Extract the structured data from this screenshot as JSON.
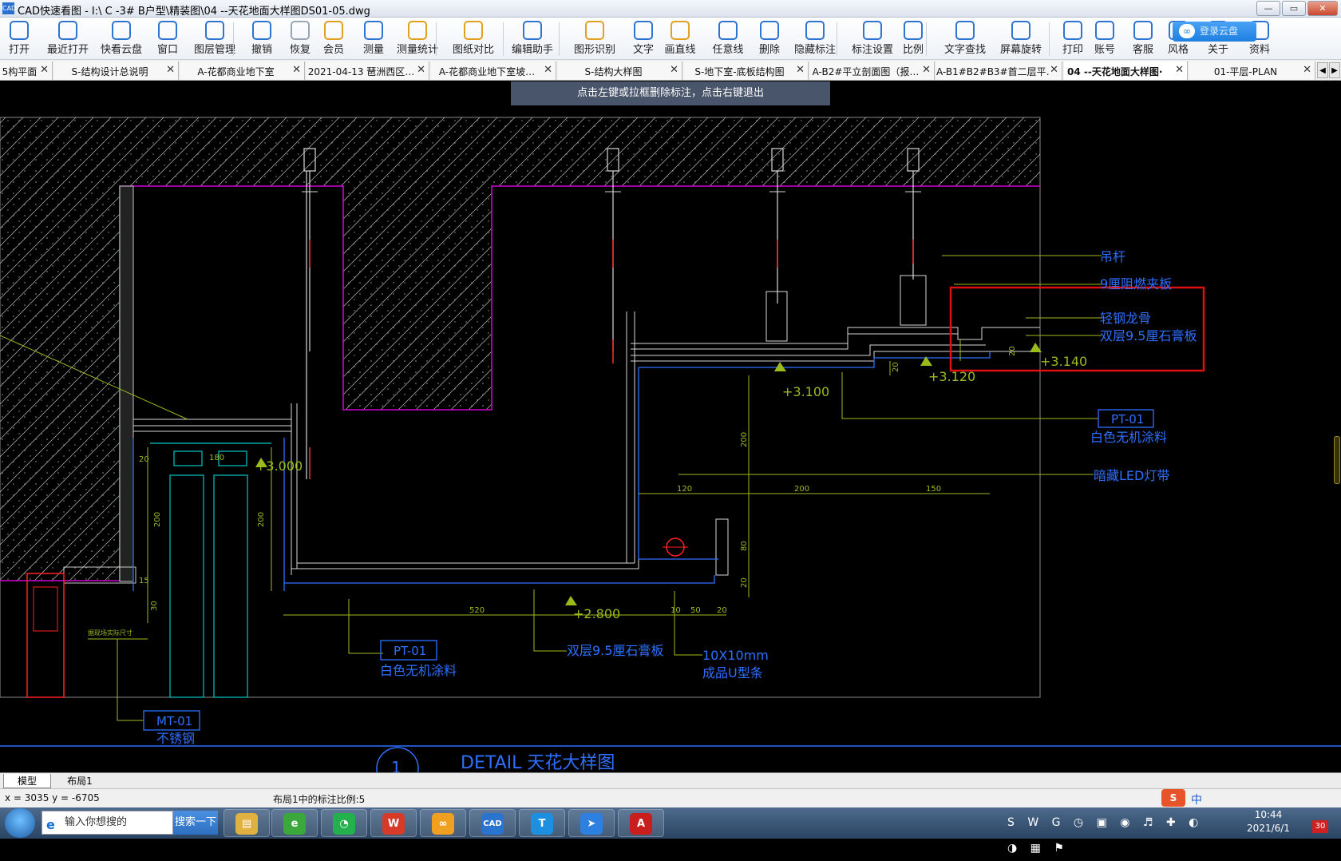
{
  "window": {
    "title": "CAD快速看图 - I:\\ C -3# B户型\\精装图\\04 --天花地面大样图DS01-05.dwg",
    "minimize": "—",
    "maximize": "▭",
    "close": "✕"
  },
  "toolbar": {
    "items": [
      {
        "label": "打开",
        "icon": "folder-open-icon"
      },
      {
        "label": "最近打开",
        "icon": "recent-clock-icon"
      },
      {
        "label": "快看云盘",
        "icon": "cloud-icon"
      },
      {
        "label": "窗口",
        "icon": "window-icon"
      },
      {
        "label": "图层管理",
        "icon": "layers-icon"
      },
      {
        "label": "撤销",
        "icon": "undo-icon"
      },
      {
        "label": "恢复",
        "icon": "redo-icon"
      },
      {
        "label": "会员",
        "icon": "vip-icon"
      },
      {
        "label": "测量",
        "icon": "measure-icon"
      },
      {
        "label": "测量统计",
        "icon": "measure-stats-icon"
      },
      {
        "label": "图纸对比",
        "icon": "compare-icon"
      },
      {
        "label": "编辑助手",
        "icon": "edit-assistant-icon"
      },
      {
        "label": "图形识别",
        "icon": "shape-recognition-icon"
      },
      {
        "label": "文字",
        "icon": "text-icon"
      },
      {
        "label": "画直线",
        "icon": "line-icon"
      },
      {
        "label": "任意线",
        "icon": "pen-icon"
      },
      {
        "label": "删除",
        "icon": "eraser-icon"
      },
      {
        "label": "隐藏标注",
        "icon": "eye-hide-icon"
      },
      {
        "label": "标注设置",
        "icon": "annotation-settings-icon"
      },
      {
        "label": "比例",
        "icon": "scale-icon"
      },
      {
        "label": "文字查找",
        "icon": "text-search-icon"
      },
      {
        "label": "屏幕旋转",
        "icon": "rotate-screen-icon"
      },
      {
        "label": "打印",
        "icon": "printer-icon"
      },
      {
        "label": "账号",
        "icon": "user-icon"
      },
      {
        "label": "客服",
        "icon": "headset-icon"
      },
      {
        "label": "风格",
        "icon": "style-icon"
      },
      {
        "label": "关于",
        "icon": "about-icon"
      },
      {
        "label": "资料",
        "icon": "docs-icon"
      }
    ],
    "cloud_button": "登录云盘"
  },
  "tabs": [
    {
      "label": "5构平面"
    },
    {
      "label": "S-结构设计总说明"
    },
    {
      "label": "A-花都商业地下室"
    },
    {
      "label": "2021-04-13 琶洲西区…"
    },
    {
      "label": "A-花都商业地下室坡…"
    },
    {
      "label": "S-结构大样图"
    },
    {
      "label": "S-地下室-底板结构图"
    },
    {
      "label": "A-B2#平立剖面图（报…"
    },
    {
      "label": "A-B1#B2#B3#首二层平…"
    },
    {
      "label": "04 --天花地面大样图·",
      "active": true
    },
    {
      "label": "01-平层-PLAN"
    }
  ],
  "tab_close": "✕",
  "tab_nav": {
    "prev": "◀",
    "next": "▶"
  },
  "hint": "点击左键或拉框删除标注，点击右键退出",
  "drawing": {
    "colors": {
      "magenta": "#d000d0",
      "cyan": "#00c8c8",
      "blue": "#2f6fff",
      "green": "#9bbb1c",
      "red": "#ff2020",
      "white": "#d8d8d8",
      "highlight": "#e01010"
    },
    "labels": {
      "hanger": "吊杆",
      "board9": "9厘阻燃夹板",
      "keel": "轻钢龙骨",
      "gypsum_a": "双层9.5厘石膏板",
      "pt01_right": "PT-01",
      "pt01_right_desc": "白色无机涂料",
      "led": "暗藏LED灯带",
      "pt01_bottom": "PT-01",
      "pt01_bottom_desc": "白色无机涂料",
      "gypsum_b": "双层9.5厘石膏板",
      "ushape": "10X10mm",
      "ushape_desc": "成品U型条",
      "mt01": "MT-01",
      "mt01_desc": "不锈钢",
      "side_note": "据现场实际尺寸",
      "detail": "DETAIL  天花大样图",
      "detail_num": "1"
    },
    "levels": [
      "+3.100",
      "+3.120",
      "+3.140",
      "+3.000",
      "+2.800"
    ],
    "dims": {
      "d520": "520",
      "d50": "50",
      "d20": "20",
      "d10": "10",
      "d120": "120",
      "d200": "200",
      "d150": "150",
      "v200": "200",
      "v80": "80",
      "v20": "20",
      "h20": "20",
      "l20": "20",
      "l200": "200",
      "l15": "15",
      "l30": "30",
      "l180": "180",
      "m200": "200"
    }
  },
  "layout_tabs": [
    {
      "label": "模型",
      "active": true
    },
    {
      "label": "布局1"
    }
  ],
  "status": {
    "coords": "x = 3035  y = -6705",
    "scale_info": "布局1中的标注比例:5"
  },
  "taskbar": {
    "search_placeholder": "输入你想搜的",
    "search_button": "搜索一下",
    "apps": [
      {
        "name": "explorer-icon",
        "color": "#e0b040",
        "glyph": "▤"
      },
      {
        "name": "browser-360-icon",
        "color": "#3aa83a",
        "glyph": "e"
      },
      {
        "name": "wechat-icon",
        "color": "#22b14c",
        "glyph": "◔"
      },
      {
        "name": "wps-icon",
        "color": "#d83a2a",
        "glyph": "W"
      },
      {
        "name": "cloud-drive-icon",
        "color": "#f0a020",
        "glyph": "∞"
      },
      {
        "name": "cad-viewer-icon",
        "color": "#2a74d0",
        "glyph": "CAD"
      },
      {
        "name": "tim-icon",
        "color": "#1c8fe0",
        "glyph": "T"
      },
      {
        "name": "feishu-icon",
        "color": "#2d7fe0",
        "glyph": "➤"
      },
      {
        "name": "autocad-icon",
        "color": "#c81e1e",
        "glyph": "A"
      }
    ],
    "time": "10:44",
    "date": "2021/6/1",
    "ime": "中",
    "badge": "30"
  }
}
